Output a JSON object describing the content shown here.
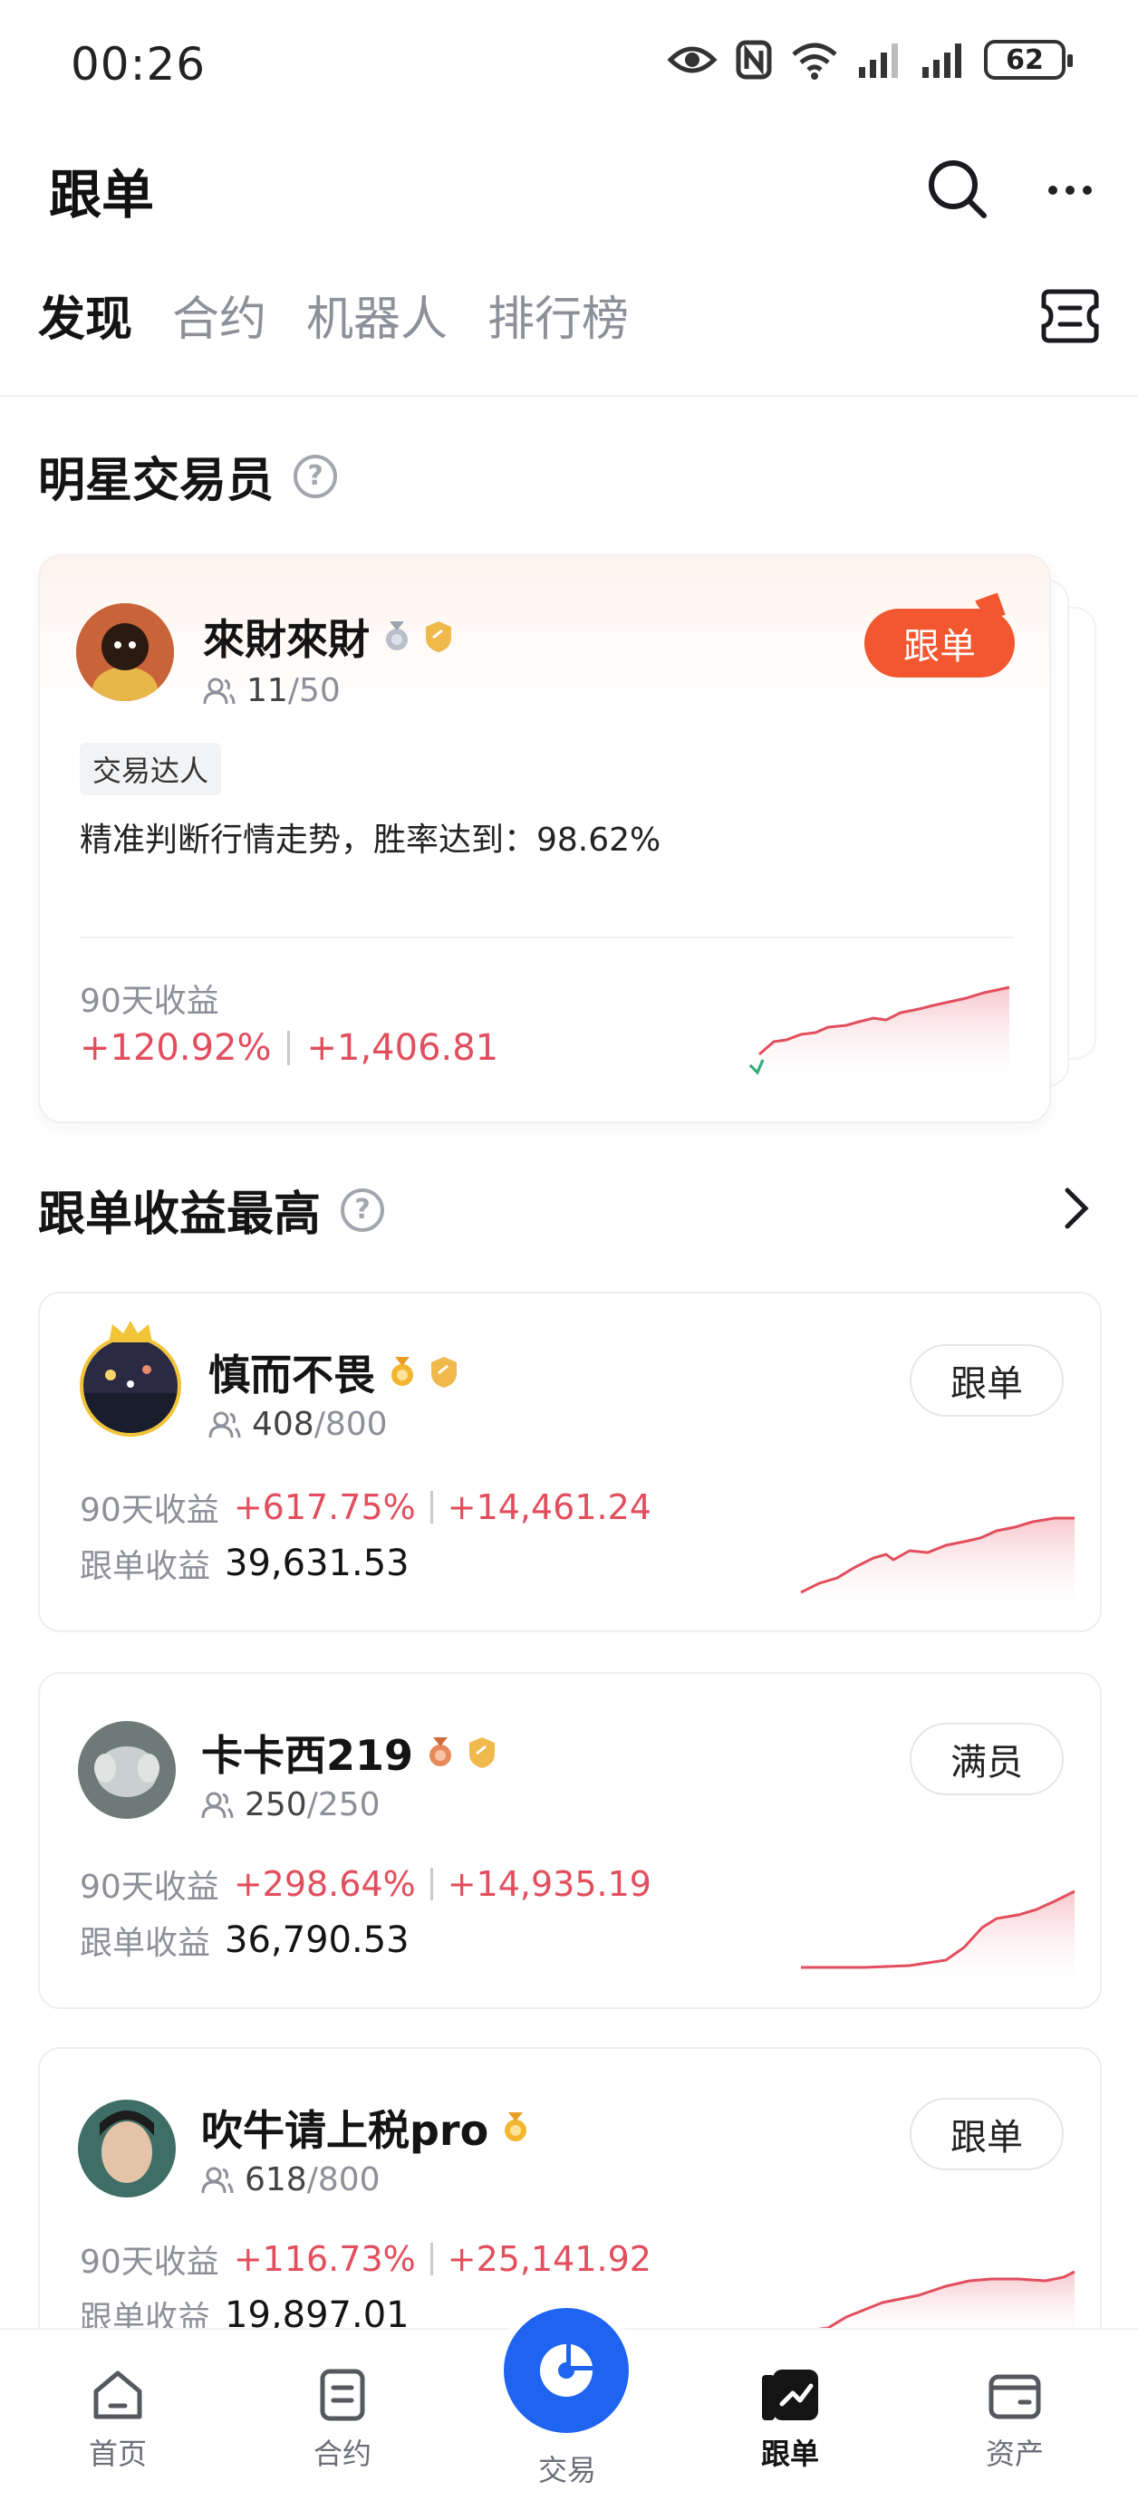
{
  "status_bar": {
    "time": "00:26",
    "battery": "62"
  },
  "header": {
    "title": "跟单"
  },
  "tabs": [
    {
      "label": "发现",
      "active": true
    },
    {
      "label": "合约",
      "active": false
    },
    {
      "label": "机器人",
      "active": false
    },
    {
      "label": "排行榜",
      "active": false
    }
  ],
  "star_section": {
    "title": "明星交易员",
    "card": {
      "name": "來財來財",
      "followers": "11",
      "followers_max": "/50",
      "follow_label": "跟单",
      "tag": "交易达人",
      "description": "精准判断行情走势，胜率达到：98.62%",
      "profit_label": "90天收益",
      "profit_pct": "+120.92%",
      "profit_amount": "+1,406.81"
    }
  },
  "top_section": {
    "title": "跟单收益最高",
    "traders": [
      {
        "name": "慎而不畏",
        "followers": "408",
        "followers_max": "/800",
        "button": "跟单",
        "profit_label": "90天收益",
        "profit_pct": "+617.75%",
        "profit_amount": "+14,461.24",
        "copy_label": "跟单收益",
        "copy_profit": "39,631.53"
      },
      {
        "name": "卡卡西219",
        "followers": "250",
        "followers_max": "/250",
        "button": "满员",
        "profit_label": "90天收益",
        "profit_pct": "+298.64%",
        "profit_amount": "+14,935.19",
        "copy_label": "跟单收益",
        "copy_profit": "36,790.53"
      },
      {
        "name": "吹牛请上税pro",
        "followers": "618",
        "followers_max": "/800",
        "button": "跟单",
        "profit_label": "90天收益",
        "profit_pct": "+116.73%",
        "profit_amount": "+25,141.92",
        "copy_label": "跟单收益",
        "copy_profit": "19,897.01"
      }
    ]
  },
  "bottom_nav": [
    {
      "label": "首页",
      "icon": "home-icon"
    },
    {
      "label": "合约",
      "icon": "contract-icon"
    },
    {
      "label": "交易",
      "icon": "trade-icon"
    },
    {
      "label": "跟单",
      "icon": "copy-trade-icon",
      "active": true
    },
    {
      "label": "资产",
      "icon": "wallet-icon"
    }
  ],
  "colors": {
    "accent_red": "#e24e5d",
    "follow_orange": "#f2572f",
    "nav_blue": "#1e64f0"
  }
}
